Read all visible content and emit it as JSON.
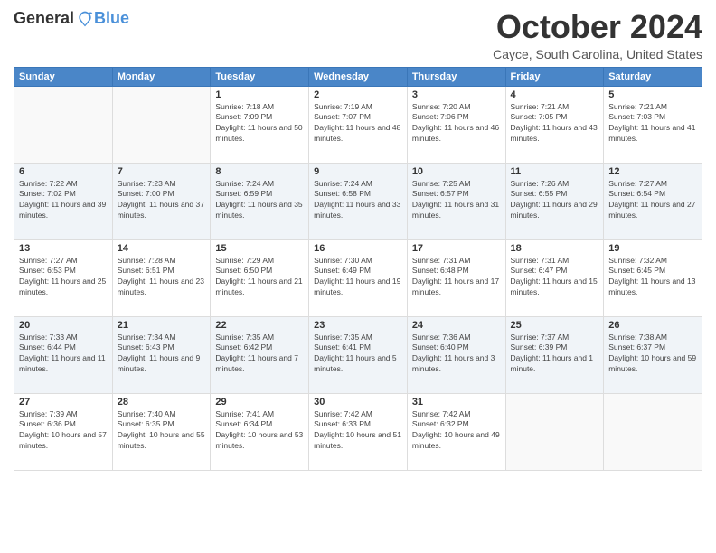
{
  "logo": {
    "general": "General",
    "blue": "Blue"
  },
  "header": {
    "month_title": "October 2024",
    "location": "Cayce, South Carolina, United States"
  },
  "weekdays": [
    "Sunday",
    "Monday",
    "Tuesday",
    "Wednesday",
    "Thursday",
    "Friday",
    "Saturday"
  ],
  "weeks": [
    [
      {
        "day": "",
        "sunrise": "",
        "sunset": "",
        "daylight": ""
      },
      {
        "day": "",
        "sunrise": "",
        "sunset": "",
        "daylight": ""
      },
      {
        "day": "1",
        "sunrise": "Sunrise: 7:18 AM",
        "sunset": "Sunset: 7:09 PM",
        "daylight": "Daylight: 11 hours and 50 minutes."
      },
      {
        "day": "2",
        "sunrise": "Sunrise: 7:19 AM",
        "sunset": "Sunset: 7:07 PM",
        "daylight": "Daylight: 11 hours and 48 minutes."
      },
      {
        "day": "3",
        "sunrise": "Sunrise: 7:20 AM",
        "sunset": "Sunset: 7:06 PM",
        "daylight": "Daylight: 11 hours and 46 minutes."
      },
      {
        "day": "4",
        "sunrise": "Sunrise: 7:21 AM",
        "sunset": "Sunset: 7:05 PM",
        "daylight": "Daylight: 11 hours and 43 minutes."
      },
      {
        "day": "5",
        "sunrise": "Sunrise: 7:21 AM",
        "sunset": "Sunset: 7:03 PM",
        "daylight": "Daylight: 11 hours and 41 minutes."
      }
    ],
    [
      {
        "day": "6",
        "sunrise": "Sunrise: 7:22 AM",
        "sunset": "Sunset: 7:02 PM",
        "daylight": "Daylight: 11 hours and 39 minutes."
      },
      {
        "day": "7",
        "sunrise": "Sunrise: 7:23 AM",
        "sunset": "Sunset: 7:00 PM",
        "daylight": "Daylight: 11 hours and 37 minutes."
      },
      {
        "day": "8",
        "sunrise": "Sunrise: 7:24 AM",
        "sunset": "Sunset: 6:59 PM",
        "daylight": "Daylight: 11 hours and 35 minutes."
      },
      {
        "day": "9",
        "sunrise": "Sunrise: 7:24 AM",
        "sunset": "Sunset: 6:58 PM",
        "daylight": "Daylight: 11 hours and 33 minutes."
      },
      {
        "day": "10",
        "sunrise": "Sunrise: 7:25 AM",
        "sunset": "Sunset: 6:57 PM",
        "daylight": "Daylight: 11 hours and 31 minutes."
      },
      {
        "day": "11",
        "sunrise": "Sunrise: 7:26 AM",
        "sunset": "Sunset: 6:55 PM",
        "daylight": "Daylight: 11 hours and 29 minutes."
      },
      {
        "day": "12",
        "sunrise": "Sunrise: 7:27 AM",
        "sunset": "Sunset: 6:54 PM",
        "daylight": "Daylight: 11 hours and 27 minutes."
      }
    ],
    [
      {
        "day": "13",
        "sunrise": "Sunrise: 7:27 AM",
        "sunset": "Sunset: 6:53 PM",
        "daylight": "Daylight: 11 hours and 25 minutes."
      },
      {
        "day": "14",
        "sunrise": "Sunrise: 7:28 AM",
        "sunset": "Sunset: 6:51 PM",
        "daylight": "Daylight: 11 hours and 23 minutes."
      },
      {
        "day": "15",
        "sunrise": "Sunrise: 7:29 AM",
        "sunset": "Sunset: 6:50 PM",
        "daylight": "Daylight: 11 hours and 21 minutes."
      },
      {
        "day": "16",
        "sunrise": "Sunrise: 7:30 AM",
        "sunset": "Sunset: 6:49 PM",
        "daylight": "Daylight: 11 hours and 19 minutes."
      },
      {
        "day": "17",
        "sunrise": "Sunrise: 7:31 AM",
        "sunset": "Sunset: 6:48 PM",
        "daylight": "Daylight: 11 hours and 17 minutes."
      },
      {
        "day": "18",
        "sunrise": "Sunrise: 7:31 AM",
        "sunset": "Sunset: 6:47 PM",
        "daylight": "Daylight: 11 hours and 15 minutes."
      },
      {
        "day": "19",
        "sunrise": "Sunrise: 7:32 AM",
        "sunset": "Sunset: 6:45 PM",
        "daylight": "Daylight: 11 hours and 13 minutes."
      }
    ],
    [
      {
        "day": "20",
        "sunrise": "Sunrise: 7:33 AM",
        "sunset": "Sunset: 6:44 PM",
        "daylight": "Daylight: 11 hours and 11 minutes."
      },
      {
        "day": "21",
        "sunrise": "Sunrise: 7:34 AM",
        "sunset": "Sunset: 6:43 PM",
        "daylight": "Daylight: 11 hours and 9 minutes."
      },
      {
        "day": "22",
        "sunrise": "Sunrise: 7:35 AM",
        "sunset": "Sunset: 6:42 PM",
        "daylight": "Daylight: 11 hours and 7 minutes."
      },
      {
        "day": "23",
        "sunrise": "Sunrise: 7:35 AM",
        "sunset": "Sunset: 6:41 PM",
        "daylight": "Daylight: 11 hours and 5 minutes."
      },
      {
        "day": "24",
        "sunrise": "Sunrise: 7:36 AM",
        "sunset": "Sunset: 6:40 PM",
        "daylight": "Daylight: 11 hours and 3 minutes."
      },
      {
        "day": "25",
        "sunrise": "Sunrise: 7:37 AM",
        "sunset": "Sunset: 6:39 PM",
        "daylight": "Daylight: 11 hours and 1 minute."
      },
      {
        "day": "26",
        "sunrise": "Sunrise: 7:38 AM",
        "sunset": "Sunset: 6:37 PM",
        "daylight": "Daylight: 10 hours and 59 minutes."
      }
    ],
    [
      {
        "day": "27",
        "sunrise": "Sunrise: 7:39 AM",
        "sunset": "Sunset: 6:36 PM",
        "daylight": "Daylight: 10 hours and 57 minutes."
      },
      {
        "day": "28",
        "sunrise": "Sunrise: 7:40 AM",
        "sunset": "Sunset: 6:35 PM",
        "daylight": "Daylight: 10 hours and 55 minutes."
      },
      {
        "day": "29",
        "sunrise": "Sunrise: 7:41 AM",
        "sunset": "Sunset: 6:34 PM",
        "daylight": "Daylight: 10 hours and 53 minutes."
      },
      {
        "day": "30",
        "sunrise": "Sunrise: 7:42 AM",
        "sunset": "Sunset: 6:33 PM",
        "daylight": "Daylight: 10 hours and 51 minutes."
      },
      {
        "day": "31",
        "sunrise": "Sunrise: 7:42 AM",
        "sunset": "Sunset: 6:32 PM",
        "daylight": "Daylight: 10 hours and 49 minutes."
      },
      {
        "day": "",
        "sunrise": "",
        "sunset": "",
        "daylight": ""
      },
      {
        "day": "",
        "sunrise": "",
        "sunset": "",
        "daylight": ""
      }
    ]
  ]
}
